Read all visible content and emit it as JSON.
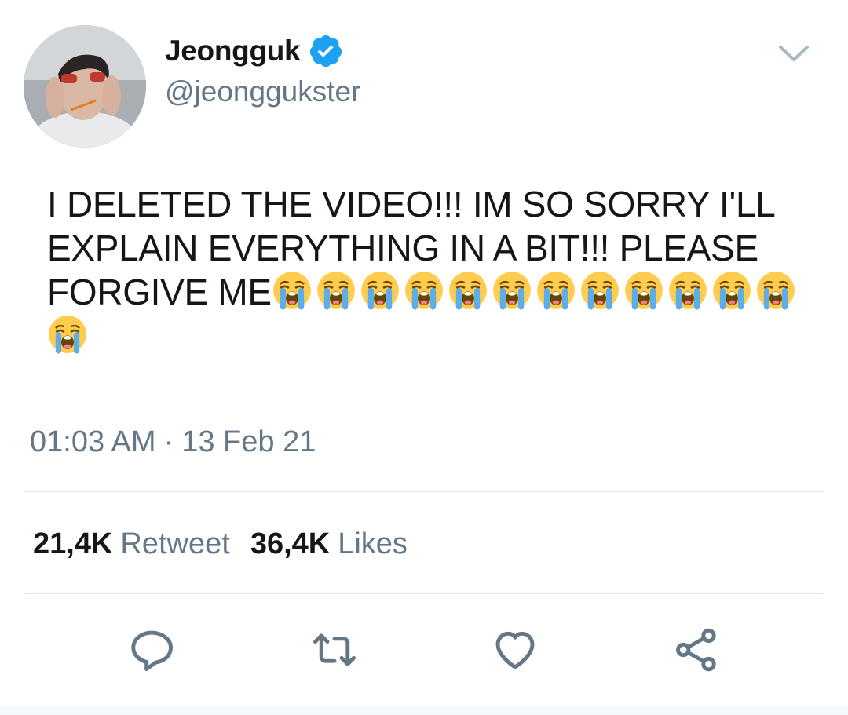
{
  "user": {
    "display_name": "Jeongguk",
    "handle": "@jeonggukster",
    "verified": true
  },
  "tweet": {
    "text_lines": [
      "I DELETED THE VIDEO!!! IM SO SORRY I'LL",
      "EXPLAIN EVERYTHING IN A BIT!!! PLEASE",
      "FORGIVE ME"
    ],
    "emoji": "loudly-crying-face",
    "emoji_count": 13
  },
  "meta": {
    "time": "01:03 AM",
    "separator": "·",
    "date": "13 Feb 21"
  },
  "stats": {
    "retweets_count": "21,4K",
    "retweets_label": "Retweet",
    "likes_count": "36,4K",
    "likes_label": "Likes"
  },
  "actions": [
    "reply-icon",
    "retweet-icon",
    "like-icon",
    "share-icon"
  ],
  "colors": {
    "text": "#14171a",
    "secondary": "#657786",
    "verified": "#1da1f2",
    "divider": "#e1e8ed"
  }
}
